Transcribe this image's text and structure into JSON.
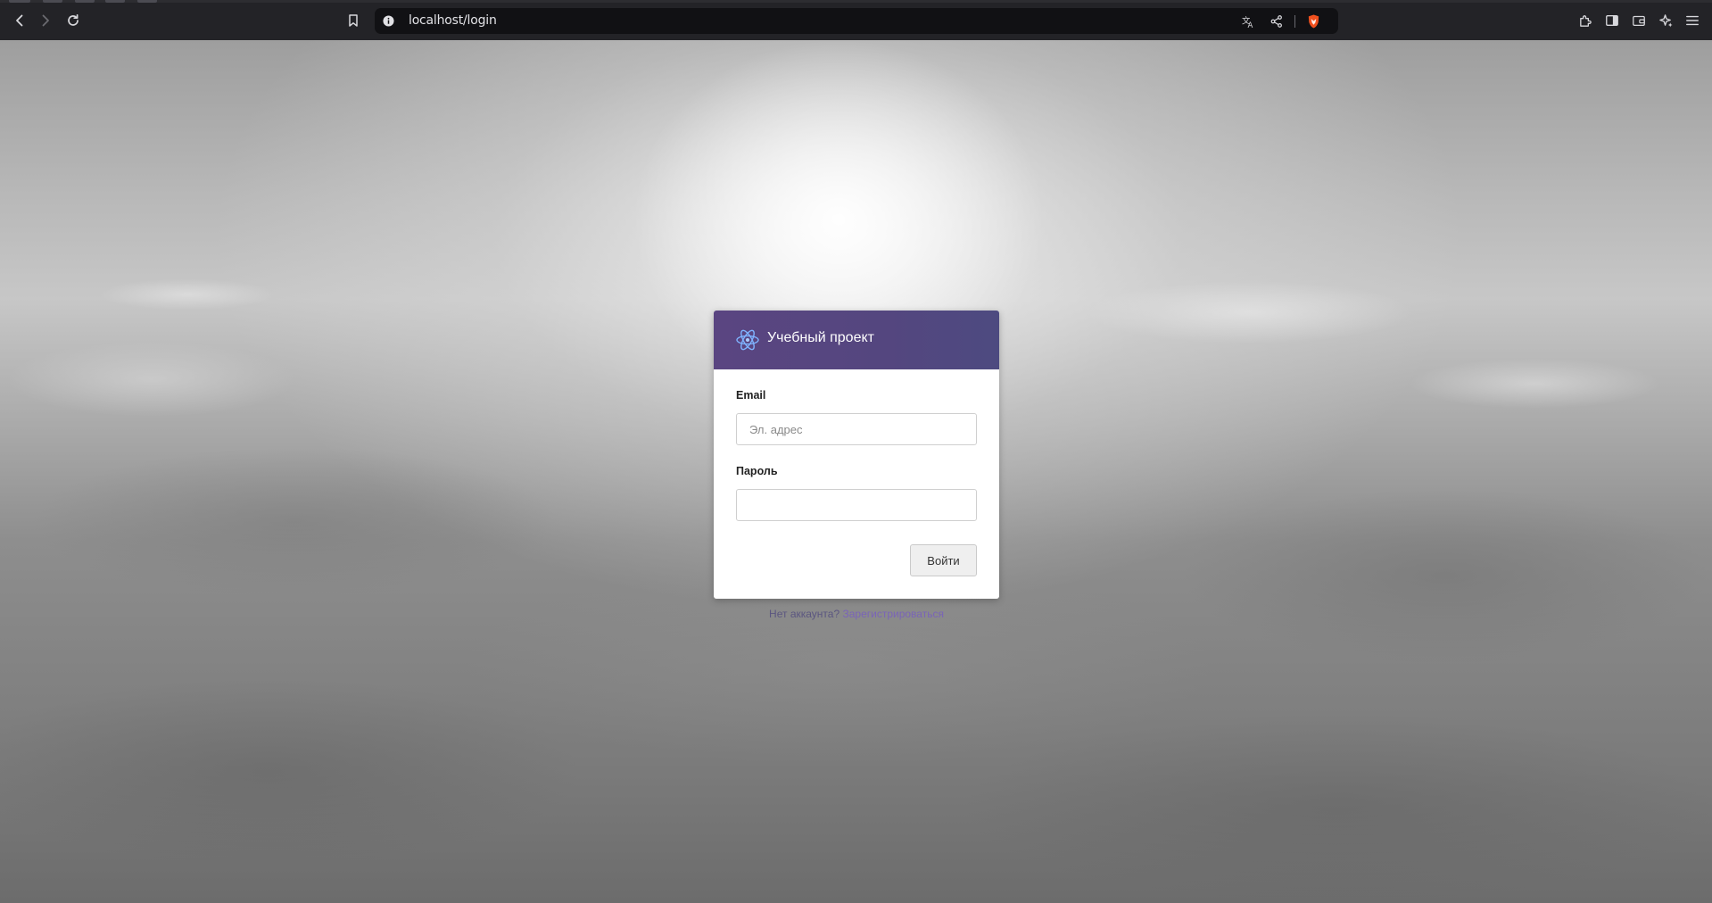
{
  "browser": {
    "url": "localhost/login",
    "nav": {
      "back_icon": "chevron-left-icon",
      "forward_icon": "chevron-right-icon",
      "reload_icon": "reload-icon"
    },
    "url_icons": [
      "bookmark-icon",
      "site-info-icon",
      "translate-icon",
      "share-icon",
      "brave-shield-icon"
    ],
    "toolbar_icons": [
      "extensions-icon",
      "sidebar-icon",
      "wallet-icon",
      "leo-ai-icon",
      "menu-icon"
    ]
  },
  "login": {
    "brand": "Учебный проект",
    "email_label": "Email",
    "email_placeholder": "Эл. адрес",
    "email_value": "",
    "password_label": "Пароль",
    "password_value": "",
    "submit_label": "Войти"
  },
  "register": {
    "prompt": "Нет аккаунта?",
    "link_label": "Зарегистрироваться"
  },
  "colors": {
    "header": "#54467f",
    "link": "#7a64b8",
    "shield": "#f0501e"
  }
}
